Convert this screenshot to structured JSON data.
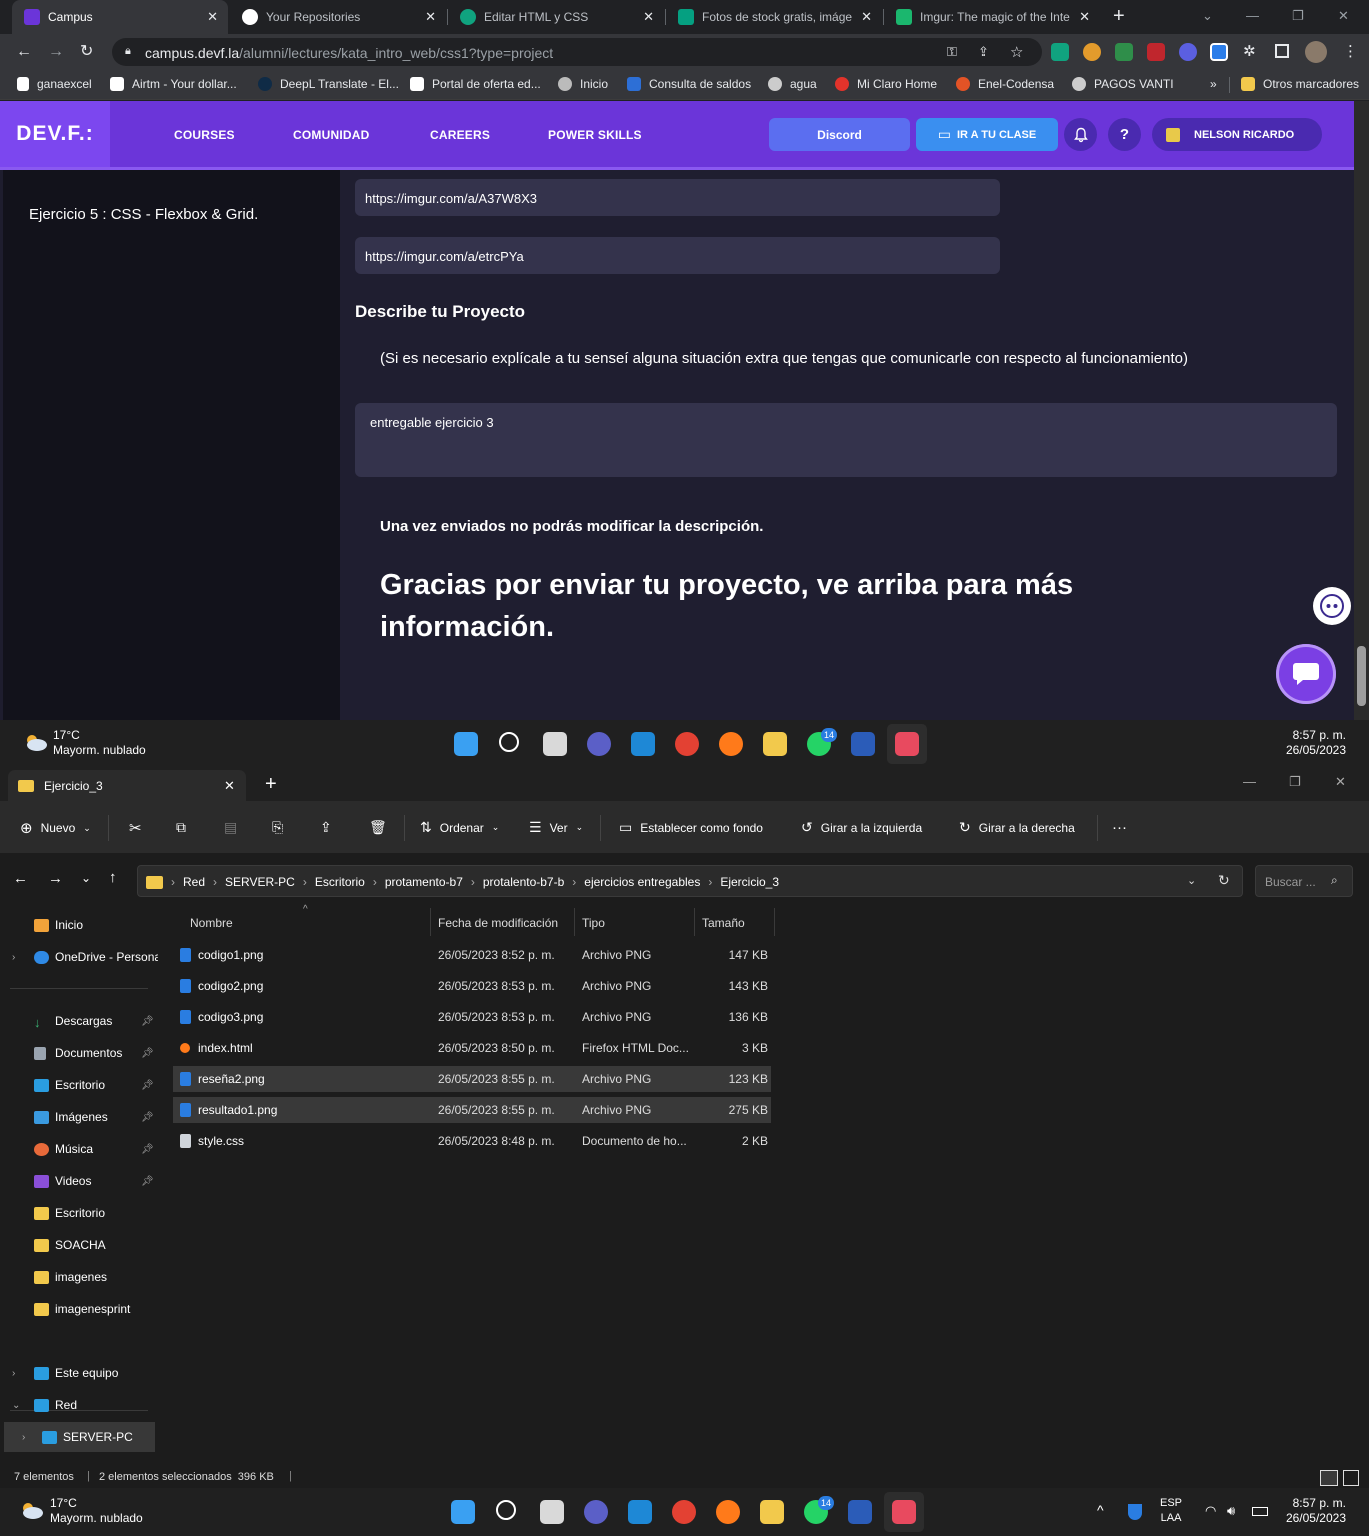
{
  "browser": {
    "tabs": [
      {
        "title": "Campus",
        "active": true
      },
      {
        "title": "Your Repositories",
        "active": false
      },
      {
        "title": "Editar HTML y CSS",
        "active": false
      },
      {
        "title": "Fotos de stock gratis, imágen",
        "active": false
      },
      {
        "title": "Imgur: The magic of the Inte",
        "active": false
      }
    ],
    "url_host": "campus.devf.la",
    "url_path": "/alumni/lectures/kata_intro_web/css1?type=project",
    "bookmarks": [
      "ganaexcel",
      "Airtm - Your dollar...",
      "DeepL Translate - El...",
      "Portal de oferta ed...",
      "Inicio",
      "Consulta de saldos",
      "agua",
      "Mi Claro Home",
      "Enel-Codensa",
      "PAGOS VANTI"
    ],
    "bookmarks_overflow": "»",
    "other_bookmarks": "Otros marcadores"
  },
  "site": {
    "logo": "DEV.F.:",
    "nav": [
      "COURSES",
      "COMUNIDAD",
      "CAREERS",
      "POWER SKILLS"
    ],
    "discord_label": "Discord",
    "class_label": "IR A TU CLASE",
    "help_label": "?",
    "user_name": "NELSON RICARDO",
    "sidebar_item": "Ejercicio 5 : CSS - Flexbox & Grid.",
    "url_fields": [
      "https://imgur.com/a/A37W8X3",
      "https://imgur.com/a/etrcPYa"
    ],
    "describe_title": "Describe tu Proyecto",
    "describe_help": "(Si es necesario explícale a tu senseí alguna situación extra que tengas que comunicarle con respecto al funcionamiento)",
    "description_value": "entregable ejercicio 3",
    "note": "Una vez enviados no podrás modificar la descripción.",
    "thanks": "Gracias por enviar tu proyecto, ve arriba para más información."
  },
  "taskbar": {
    "temp": "17°C",
    "weather": "Mayorm. nublado",
    "time": "8:57 p. m.",
    "date": "26/05/2023",
    "whatsapp_badge": "14",
    "lang": "ESP",
    "lang2": "LAA"
  },
  "explorer": {
    "tab_title": "Ejercicio_3",
    "commands": {
      "new": "Nuevo",
      "sort": "Ordenar",
      "view": "Ver",
      "set_bg": "Establecer como fondo",
      "rotate_left": "Girar a la izquierda",
      "rotate_right": "Girar a la derecha",
      "more": "···"
    },
    "breadcrumb": [
      "Red",
      "SERVER-PC",
      "Escritorio",
      "protamento-b7",
      "protalento-b7-b",
      "ejercicios entregables",
      "Ejercicio_3"
    ],
    "search_placeholder": "Buscar ...",
    "nav_items": [
      {
        "label": "Inicio",
        "icon": "home-icon"
      },
      {
        "label": "OneDrive - Persona",
        "icon": "cloud-icon"
      },
      {
        "label": "Descargas",
        "icon": "download-icon"
      },
      {
        "label": "Documentos",
        "icon": "document-icon"
      },
      {
        "label": "Escritorio",
        "icon": "desktop-icon"
      },
      {
        "label": "Imágenes",
        "icon": "image-icon"
      },
      {
        "label": "Música",
        "icon": "music-icon"
      },
      {
        "label": "Videos",
        "icon": "video-icon"
      },
      {
        "label": "Escritorio",
        "icon": "folder-icon"
      },
      {
        "label": "SOACHA",
        "icon": "folder-icon"
      },
      {
        "label": "imagenes",
        "icon": "folder-icon"
      },
      {
        "label": "imagenesprint",
        "icon": "folder-icon"
      },
      {
        "label": "Este equipo",
        "icon": "computer-icon"
      },
      {
        "label": "Red",
        "icon": "network-icon"
      },
      {
        "label": "SERVER-PC",
        "icon": "server-icon"
      }
    ],
    "columns": [
      "Nombre",
      "Fecha de modificación",
      "Tipo",
      "Tamaño"
    ],
    "files": [
      {
        "name": "codigo1.png",
        "date": "26/05/2023 8:52 p. m.",
        "type": "Archivo PNG",
        "size": "147 KB",
        "selected": false
      },
      {
        "name": "codigo2.png",
        "date": "26/05/2023 8:53 p. m.",
        "type": "Archivo PNG",
        "size": "143 KB",
        "selected": false
      },
      {
        "name": "codigo3.png",
        "date": "26/05/2023 8:53 p. m.",
        "type": "Archivo PNG",
        "size": "136 KB",
        "selected": false
      },
      {
        "name": "index.html",
        "date": "26/05/2023 8:50 p. m.",
        "type": "Firefox HTML Doc...",
        "size": "3 KB",
        "selected": false
      },
      {
        "name": "reseña2.png",
        "date": "26/05/2023 8:55 p. m.",
        "type": "Archivo PNG",
        "size": "123 KB",
        "selected": true
      },
      {
        "name": "resultado1.png",
        "date": "26/05/2023 8:55 p. m.",
        "type": "Archivo PNG",
        "size": "275 KB",
        "selected": true
      },
      {
        "name": "style.css",
        "date": "26/05/2023 8:48 p. m.",
        "type": "Documento de ho...",
        "size": "2 KB",
        "selected": false
      }
    ],
    "status_count": "7 elementos",
    "status_selected": "2 elementos seleccionados  396 KB"
  }
}
